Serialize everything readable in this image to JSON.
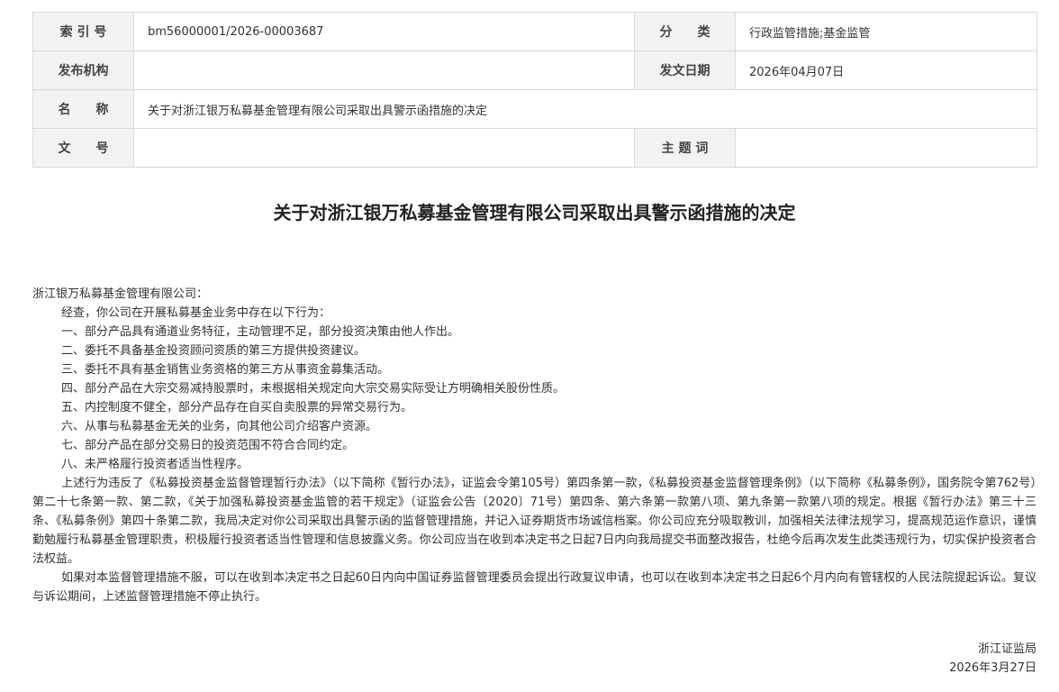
{
  "meta": {
    "index_label": "索 引 号",
    "index_value": "bm56000001/2026-00003687",
    "category_label": "分　　类",
    "category_value": "行政监管措施;基金监管",
    "publisher_label": "发布机构",
    "publisher_value": "",
    "date_label": "发文日期",
    "date_value": "2026年04月07日",
    "name_label": "名　　称",
    "name_value": "关于对浙江银万私募基金管理有限公司采取出具警示函措施的决定",
    "docno_label": "文　　号",
    "docno_value": "",
    "keywords_label": "主 题 词",
    "keywords_value": ""
  },
  "document": {
    "title": "关于对浙江银万私募基金管理有限公司采取出具警示函措施的决定",
    "addressee": "浙江银万私募基金管理有限公司：",
    "intro": "经查，你公司在开展私募基金业务中存在以下行为：",
    "items": [
      "一、部分产品具有通道业务特征，主动管理不足，部分投资决策由他人作出。",
      "二、委托不具备基金投资顾问资质的第三方提供投资建议。",
      "三、委托不具有基金销售业务资格的第三方从事资金募集活动。",
      "四、部分产品在大宗交易减持股票时，未根据相关规定向大宗交易实际受让方明确相关股份性质。",
      "五、内控制度不健全，部分产品存在自买自卖股票的异常交易行为。",
      "六、从事与私募基金无关的业务，向其他公司介绍客户资源。",
      "七、部分产品在部分交易日的投资范围不符合合同约定。",
      "八、未严格履行投资者适当性程序。"
    ],
    "decision": "上述行为违反了《私募投资基金监督管理暂行办法》（以下简称《暂行办法》，证监会令第105号）第四条第一款，《私募投资基金监督管理条例》（以下简称《私募条例》，国务院令第762号）第二十七条第一款、第二款，《关于加强私募投资基金监管的若干规定》（证监会公告〔2020〕71号）第四条、第六条第一款第八项、第九条第一款第八项的规定。根据《暂行办法》第三十三条、《私募条例》第四十条第二款，我局决定对你公司采取出具警示函的监督管理措施，并记入证券期货市场诚信档案。你公司应充分吸取教训，加强相关法律法规学习，提高规范运作意识，谨慎勤勉履行私募基金管理职责，积极履行投资者适当性管理和信息披露义务。你公司应当在收到本决定书之日起7日内向我局提交书面整改报告，杜绝今后再次发生此类违规行为，切实保护投资者合法权益。",
    "appeal": "如果对本监督管理措施不服，可以在收到本决定书之日起60日内向中国证券监督管理委员会提出行政复议申请，也可以在收到本决定书之日起6个月内向有管辖权的人民法院提起诉讼。复议与诉讼期间，上述监督管理措施不停止执行。",
    "issuer": "浙江证监局",
    "sign_date": "2026年3月27日"
  }
}
